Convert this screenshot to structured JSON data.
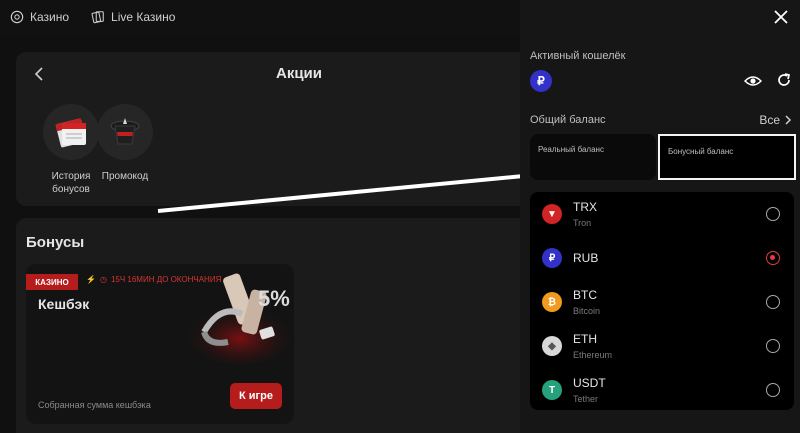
{
  "nav": {
    "items": [
      {
        "label": "Казино",
        "icon": "casino-chip-icon"
      },
      {
        "label": "Live Казино",
        "icon": "live-cards-icon"
      }
    ]
  },
  "promotions": {
    "title": "Акции",
    "tiles": [
      {
        "label_line1": "История",
        "label_line2": "бонусов",
        "icon": "calendar-icon"
      },
      {
        "label_line1": "Промокод",
        "label_line2": "",
        "icon": "magic-hat-icon"
      }
    ]
  },
  "bonuses": {
    "title": "Бонусы",
    "card": {
      "tag": "КАЗИНО",
      "timer": "15Ч 16МИН ДО ОКОНЧАНИЯ",
      "name": "Кешбэк",
      "caption": "Собранная сумма кешбэка",
      "play_label": "К игре",
      "art_percent": "5%"
    }
  },
  "wallet": {
    "active_label": "Активный кошелёк",
    "active_symbol": "₽",
    "total_label": "Общий баланс",
    "all_link": "Все",
    "real_balance_label": "Реальный баланс",
    "bonus_balance_label": "Бонусный баланс",
    "currencies": [
      {
        "code": "TRX",
        "name": "Tron",
        "symbol": "▼",
        "color": "#d22424",
        "selected": false
      },
      {
        "code": "RUB",
        "name": "",
        "symbol": "₽",
        "color": "#3232c8",
        "selected": true
      },
      {
        "code": "BTC",
        "name": "Bitcoin",
        "symbol": "₿",
        "color": "#f29a1f",
        "selected": false
      },
      {
        "code": "ETH",
        "name": "Ethereum",
        "symbol": "◆",
        "color": "#d8d8d8",
        "selected": false
      },
      {
        "code": "USDT",
        "name": "Tether",
        "symbol": "T",
        "color": "#26a17b",
        "selected": false
      }
    ]
  },
  "colors": {
    "accent": "#b51c1c",
    "radio_selected": "#e23c3c",
    "panel_bg": "#161616"
  }
}
